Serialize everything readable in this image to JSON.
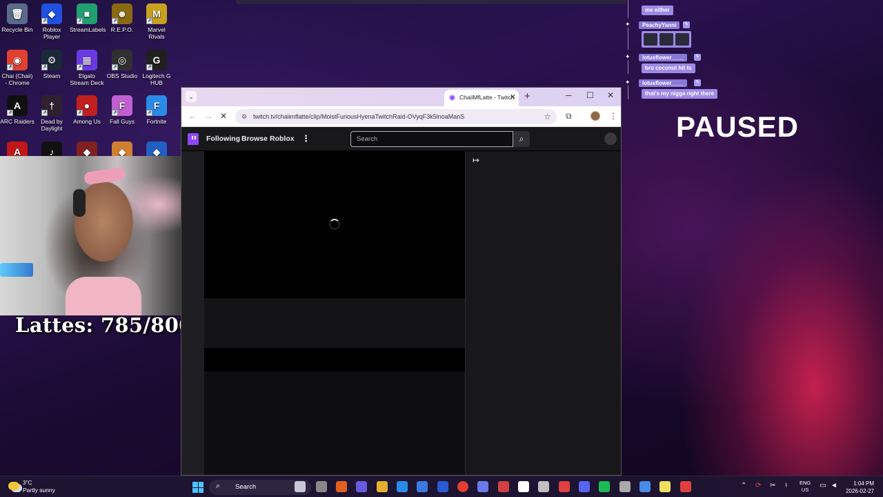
{
  "desktop": {
    "icons": [
      {
        "label": "Recycle Bin",
        "glyph": "🗑",
        "color": "#5a6a8a"
      },
      {
        "label": "Roblox Player",
        "glyph": "◆",
        "color": "#2050e0"
      },
      {
        "label": "StreamLabels",
        "glyph": "■",
        "color": "#20a070"
      },
      {
        "label": "R.E.P.O.",
        "glyph": "☻",
        "color": "#8a6a10"
      },
      {
        "label": "Marvel Rivals",
        "glyph": "M",
        "color": "#c8a020"
      },
      {
        "label": "Chai (Chaii) - Chrome",
        "glyph": "◉",
        "color": "#e04030"
      },
      {
        "label": "Steam",
        "glyph": "⚙",
        "color": "#1b2838"
      },
      {
        "label": "Elgato Stream Deck",
        "glyph": "▦",
        "color": "#6a3ae0"
      },
      {
        "label": "OBS Studio",
        "glyph": "◎",
        "color": "#303030"
      },
      {
        "label": "Logitech G HUB",
        "glyph": "G",
        "color": "#202020"
      },
      {
        "label": "ARC Raiders",
        "glyph": "A",
        "color": "#101010"
      },
      {
        "label": "Dead by Daylight",
        "glyph": "†",
        "color": "#302030"
      },
      {
        "label": "Among Us",
        "glyph": "●",
        "color": "#c02020"
      },
      {
        "label": "Fall Guys",
        "glyph": "F",
        "color": "#c060d0"
      },
      {
        "label": "Fortnite",
        "glyph": "F",
        "color": "#2a8ae8"
      },
      {
        "label": "",
        "glyph": "A",
        "color": "#c01818"
      },
      {
        "label": "",
        "glyph": "♪",
        "color": "#111111"
      },
      {
        "label": "",
        "glyph": "◆",
        "color": "#802020"
      },
      {
        "label": "",
        "glyph": "◆",
        "color": "#d08030"
      },
      {
        "label": "",
        "glyph": "◆",
        "color": "#2060c0"
      }
    ]
  },
  "overlay": {
    "lattes_text": "Lattes: 785/800",
    "paused_text": "PAUSED"
  },
  "chat": {
    "lines": [
      {
        "name": "PeachyYanni",
        "message": "me either"
      },
      {
        "name": "PeachyYanni",
        "message": ""
      },
      {
        "name": "lotusflower____",
        "message": "bro coconut hit ts"
      },
      {
        "name": "lotusflower____",
        "message": "that's my nigga right there"
      }
    ]
  },
  "browser": {
    "tab_title": "ChaiiMfLatte - Twitch",
    "url": "twitch.tv/chaiimflatte/clip/MoistFuriousHyenaTwitchRaid-OVyqF3k5lnoaManS",
    "nav": {
      "following": "Following",
      "browse": "Browse",
      "roblox": "Roblox"
    },
    "search_placeholder": "Search"
  },
  "taskbar": {
    "weather_temp": "3°C",
    "weather_desc": "Partly sunny",
    "search_label": "Search",
    "lang_line1": "ENG",
    "lang_line2": "US",
    "time": "1:04 PM",
    "date": "2026-02-27"
  },
  "colors": {
    "twitch_purple": "#9146ff",
    "chat_bubble": "#9d8ae6"
  }
}
